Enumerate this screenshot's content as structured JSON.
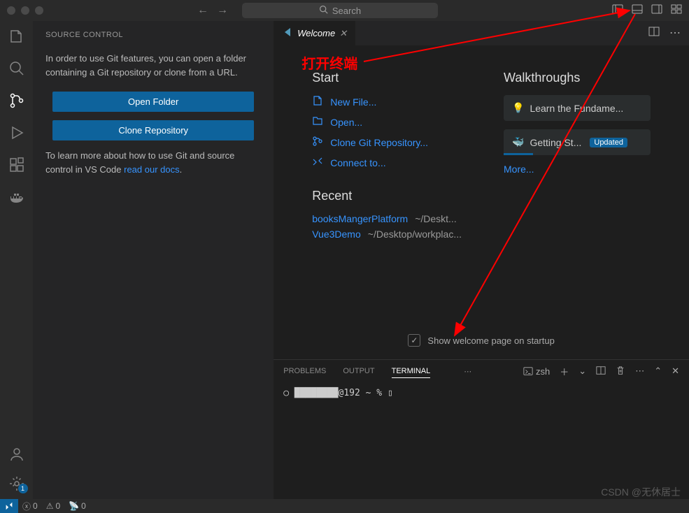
{
  "titlebar": {
    "search_placeholder": "Search"
  },
  "sidebar": {
    "title": "SOURCE CONTROL",
    "text1": "In order to use Git features, you can open a folder containing a Git repository or clone from a URL.",
    "open_folder": "Open Folder",
    "clone_repo": "Clone Repository",
    "text2_pre": "To learn more about how to use Git and source control in VS Code ",
    "text2_link": "read our docs",
    "text2_post": "."
  },
  "tabs": {
    "welcome": "Welcome"
  },
  "annotation": "打开终端",
  "welcome": {
    "start_title": "Start",
    "start_items": [
      {
        "icon": "file",
        "label": "New File..."
      },
      {
        "icon": "folder",
        "label": "Open..."
      },
      {
        "icon": "git",
        "label": "Clone Git Repository..."
      },
      {
        "icon": "connect",
        "label": "Connect to..."
      }
    ],
    "recent_title": "Recent",
    "recent_items": [
      {
        "name": "booksMangerPlatform",
        "path": "~/Deskt..."
      },
      {
        "name": "Vue3Demo",
        "path": "~/Desktop/workplac..."
      }
    ],
    "walk_title": "Walkthroughs",
    "walk_items": [
      {
        "icon": "💡",
        "label": "Learn the Fundame...",
        "badge": ""
      },
      {
        "icon": "🐳",
        "label": "Getting St...",
        "badge": "Updated"
      }
    ],
    "more": "More...",
    "startup_label": "Show welcome page on startup"
  },
  "panel": {
    "tabs": [
      "PROBLEMS",
      "OUTPUT",
      "TERMINAL"
    ],
    "active_tab": "TERMINAL",
    "shell": "zsh",
    "prompt": "○ ████████@192 ~ % ▯"
  },
  "statusbar": {
    "errors": "0",
    "warnings": "0",
    "ports": "0",
    "gear_badge": "1"
  },
  "watermark": "CSDN @无休居士"
}
